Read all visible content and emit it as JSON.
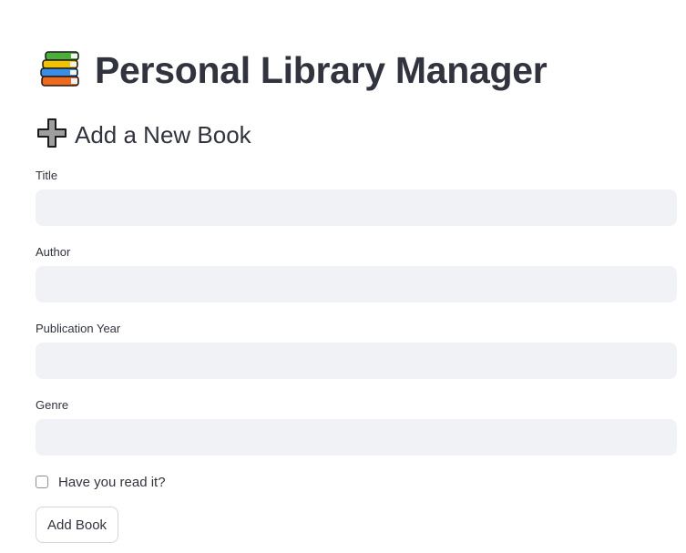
{
  "header": {
    "icon": "books-icon",
    "title": "Personal Library Manager"
  },
  "form": {
    "icon": "plus-icon",
    "heading": "Add a New Book",
    "fields": [
      {
        "label": "Title",
        "value": "",
        "placeholder": ""
      },
      {
        "label": "Author",
        "value": "",
        "placeholder": ""
      },
      {
        "label": "Publication Year",
        "value": "",
        "placeholder": ""
      },
      {
        "label": "Genre",
        "value": "",
        "placeholder": ""
      }
    ],
    "read_checkbox": {
      "label": "Have you read it?",
      "checked": false
    },
    "submit_label": "Add Book"
  },
  "colors": {
    "text": "#31333f",
    "input_background": "#f0f2f6",
    "button_border": "#d5d7dd"
  }
}
